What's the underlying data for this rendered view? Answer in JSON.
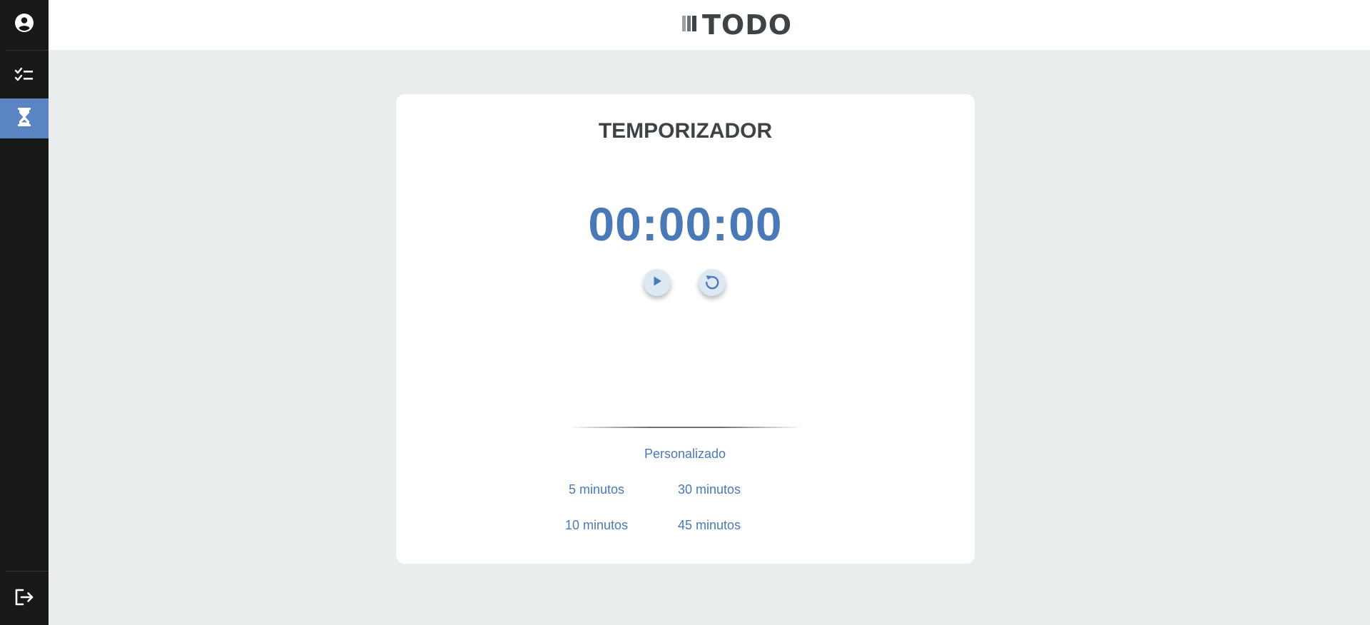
{
  "sidebar": {
    "items": [
      {
        "icon": "user-circle-icon"
      },
      {
        "icon": "checklist-icon"
      },
      {
        "icon": "hourglass-icon",
        "active": true
      }
    ],
    "bottom": {
      "icon": "logout-icon"
    }
  },
  "header": {
    "logo_text": "TODO"
  },
  "timer": {
    "title": "TEMPORIZADOR",
    "display": "00:00:00",
    "custom_label": "Personalizado",
    "presets": [
      "5 minutos",
      "30 minutos",
      "10 minutos",
      "45 minutos"
    ]
  },
  "colors": {
    "accent": "#4a79b7",
    "sidebar_bg": "#181818",
    "sidebar_active": "#5a84c2",
    "page_bg": "#e9eded",
    "title": "#3d4346"
  }
}
